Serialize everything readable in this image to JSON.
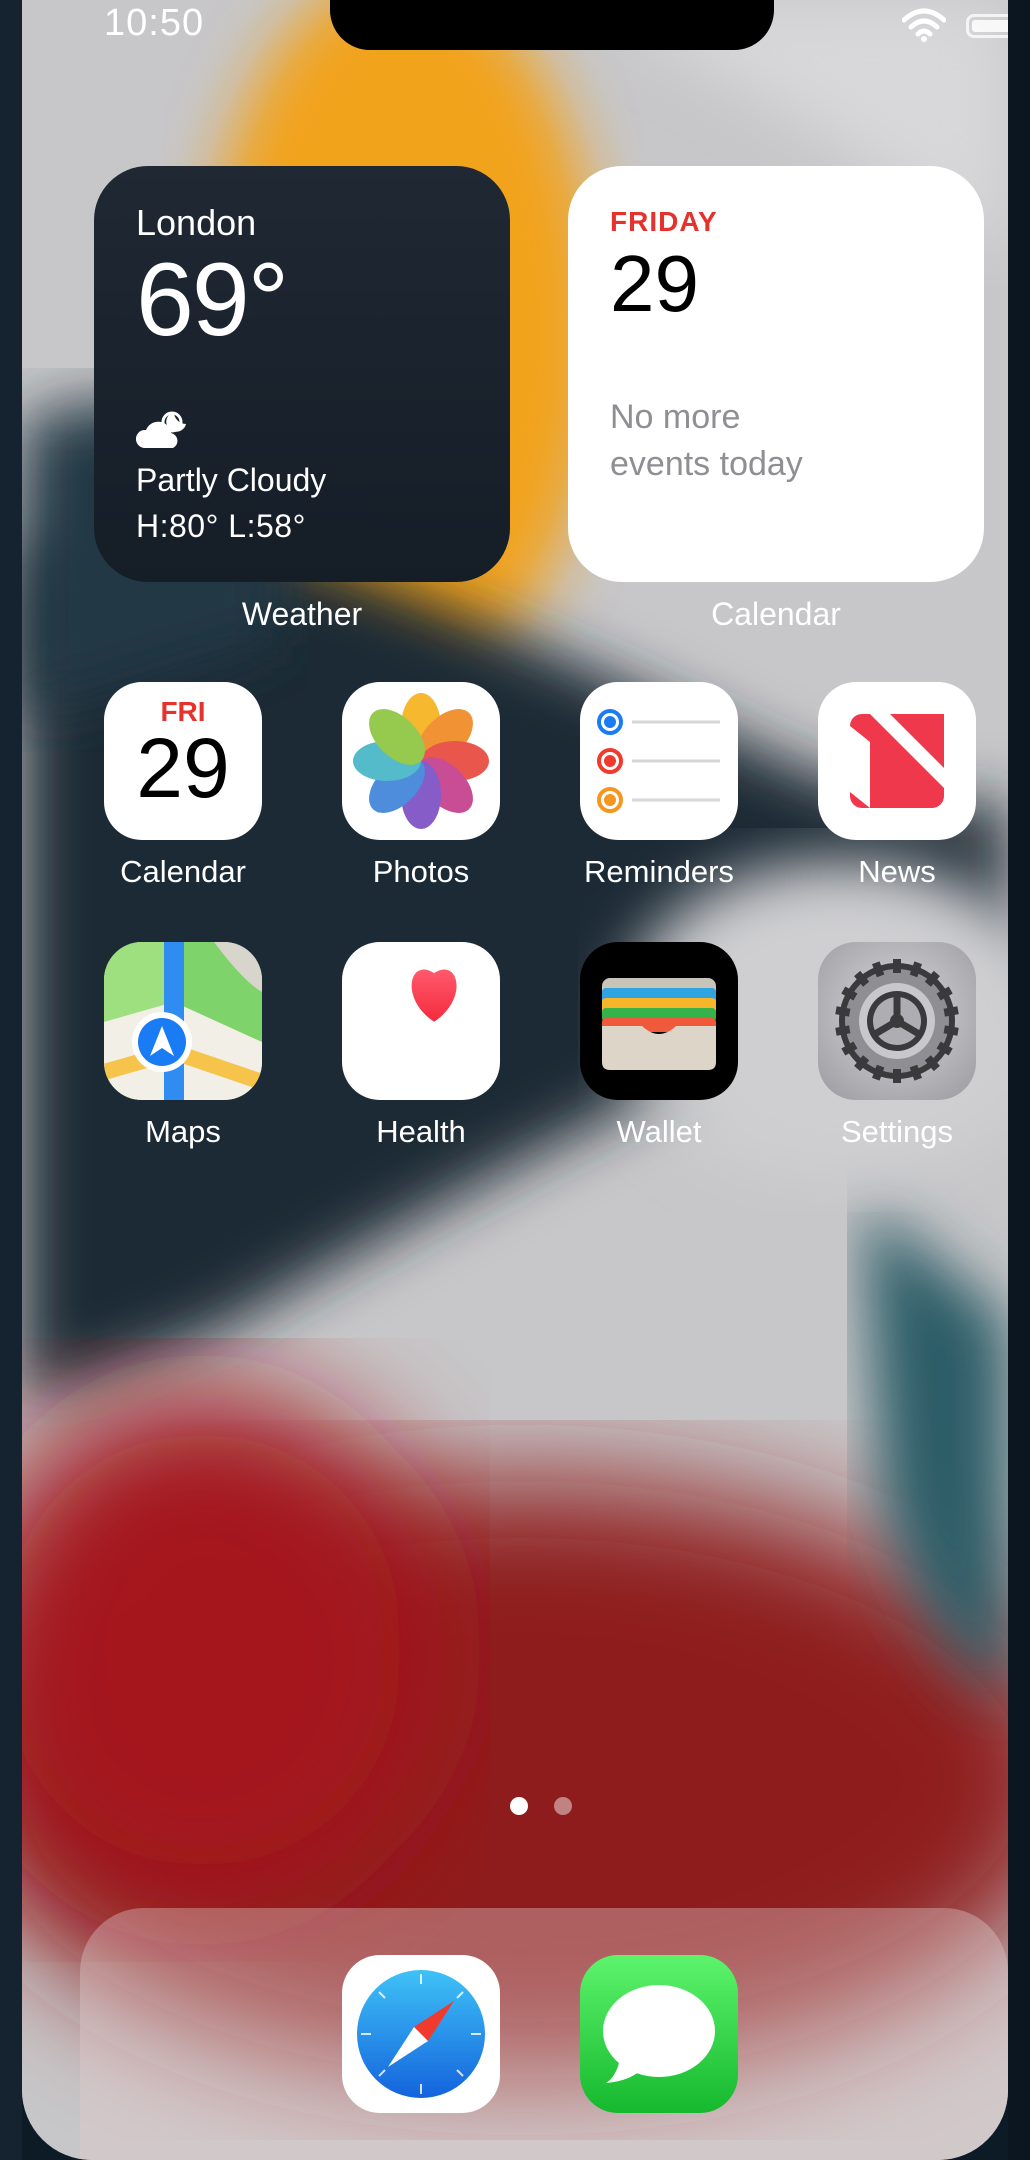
{
  "status": {
    "time": "10:50"
  },
  "weather_widget": {
    "city": "London",
    "temperature": "69°",
    "condition": "Partly Cloudy",
    "high_low": "H:80° L:58°",
    "label": "Weather"
  },
  "calendar_widget": {
    "weekday": "FRIDAY",
    "date": "29",
    "events_line1": "No more",
    "events_line2": "events today",
    "label": "Calendar"
  },
  "apps": [
    {
      "label": "Calendar",
      "badge_day": "FRI",
      "badge_date": "29"
    },
    {
      "label": "Photos"
    },
    {
      "label": "Reminders"
    },
    {
      "label": "News"
    },
    {
      "label": "Maps"
    },
    {
      "label": "Health"
    },
    {
      "label": "Wallet"
    },
    {
      "label": "Settings"
    }
  ],
  "page_indicator": {
    "pages": 2,
    "current": 1
  },
  "dock": [
    "safari-icon",
    "messages-icon"
  ],
  "colors": {
    "calendar_red": "#e5322d",
    "dock_bg": "#d8c0c0"
  }
}
